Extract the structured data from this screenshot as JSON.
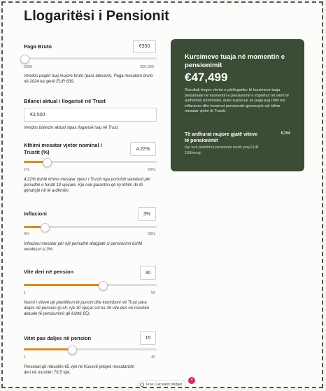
{
  "title": "Llogaritësi i Pensionit",
  "fields": [
    {
      "label": "Paga Bruto",
      "value": "€350",
      "min": "€350",
      "max": "€50,000",
      "progress": 0,
      "help": "Vendos pagën tuaj mujore bruto (para taksave). Paga mesatare bruto në 2024 ka qenë EUR 639."
    },
    {
      "label": "Bilanci aktual i llogarisë në Trust",
      "value": "€3,500",
      "help": "Vendos bilancin aktual sipas llogarisë tuaj në Trust."
    },
    {
      "label": "Kthimi mesatar vjetor nominal i Trustit (%)",
      "value": "4.22%",
      "min": "1%",
      "max": "20%",
      "progress": 0.17,
      "help": "4.22% është kthimi mesatar vjetor i Trustit nga portofoli standard për periudhë e fundit 10-vjeçare. Kjo nuk garanton që ky kthim do të qëndrojë në të ardhmën."
    },
    {
      "label": "Inflacioni",
      "value": "3%",
      "min": "0%",
      "max": "20%",
      "progress": 0.15,
      "help": "Inflacioni mesatar për një periudhë afatgjatë si pensionimi është vendosur si 3%."
    },
    {
      "label": "Vite deri në pension",
      "value": "30",
      "min": "1",
      "max": "50",
      "progress": 0.59,
      "help": "Numri i viteve që planifikoni të punoni dhe kontriboni në Trust para daljes në pension (p.sh. një 30 vjeçar sot ka 35 vite deri në moshën aktuale të pensionimit që është 65)."
    },
    {
      "label": "Vitet pas daljes në pension",
      "value": "15",
      "min": "1",
      "max": "40",
      "progress": 0.36,
      "help": "Personat që mbushin 65 vjet në Kosovë jetojnë mesatarisht deri në moshën 78.5 vjet."
    }
  ],
  "result": {
    "title": "Kursimeve tuaja në momentin e pensionimit",
    "amount": "€47,499",
    "description": "Rezultati tregon vlerën e përllogaritur të kursimeve tuaja pensionale në momentin e pensionimit e shprehur në vlerë të ardhshme (nominale), duke supozuar se paga juaj rritet me inflacionin dhe kursimet pensionale gjenerojnë një kthim mesatar vjetor të Trustit.",
    "monthly_label": "Të ardhurat mujore gjatë viteve të pensionimit",
    "monthly_value": "€264",
    "monthly_note": "Kjo nuk përfshinë pensionin bazik prej EUR 150/muaj."
  },
  "widget": {
    "label": "Free Calculator Widget",
    "close": "×"
  },
  "colors": {
    "accent": "#e08b1a",
    "card": "#3b4d35"
  }
}
